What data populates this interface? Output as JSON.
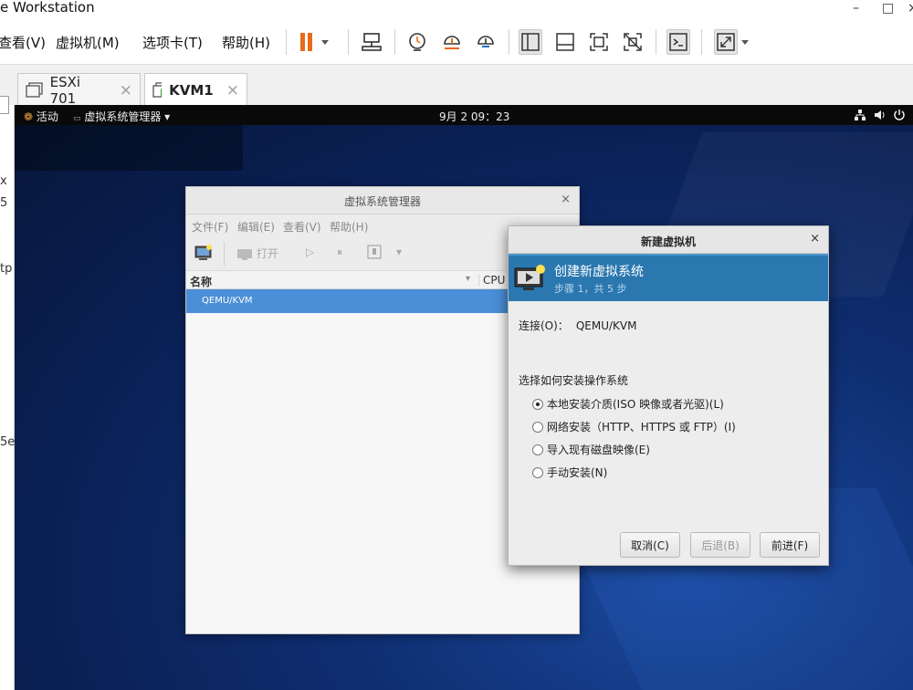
{
  "window": {
    "title": "e Workstation",
    "minimize": "–",
    "maximize": "□",
    "close": "×"
  },
  "menu": {
    "items": [
      "查看(V)",
      "虚拟机(M)",
      "选项卡(T)",
      "帮助(H)"
    ]
  },
  "tabs": [
    {
      "label": "ESXi 701",
      "close": "×"
    },
    {
      "label": "KVM1",
      "close": "×"
    }
  ],
  "sidebar_fragments": [
    "x",
    "5",
    "tp",
    "5e"
  ],
  "guest_topbar": {
    "activities": "活动",
    "app_menu": "虚拟系统管理器 ▾",
    "clock": "9月 2 09：23"
  },
  "vmm": {
    "title": "虚拟系统管理器",
    "close": "×",
    "menu": [
      "文件(F)",
      "编辑(E)",
      "查看(V)",
      "帮助(H)"
    ],
    "toolbar_open": "打开",
    "col_name": "名称",
    "col_cpu": "CPU",
    "row": "QEMU/KVM"
  },
  "newvm": {
    "title": "新建虚拟机",
    "close": "×",
    "heading": "创建新虚拟系统",
    "step": "步骤 1，共 5 步",
    "conn_label": "连接(O)：",
    "conn_value": "QEMU/KVM",
    "question": "选择如何安装操作系统",
    "options": [
      "本地安装介质(ISO 映像或者光驱)(L)",
      "网络安装（HTTP、HTTPS 或 FTP）(I)",
      "导入现有磁盘映像(E)",
      "手动安装(N)"
    ],
    "selected_option": 0,
    "btn_cancel": "取消(C)",
    "btn_back": "后退(B)",
    "btn_forward": "前进(F)"
  },
  "colors": {
    "accent_orange": "#e96a1a",
    "selection_blue": "#4a8fd7",
    "banner_blue": "#2b78b0"
  }
}
